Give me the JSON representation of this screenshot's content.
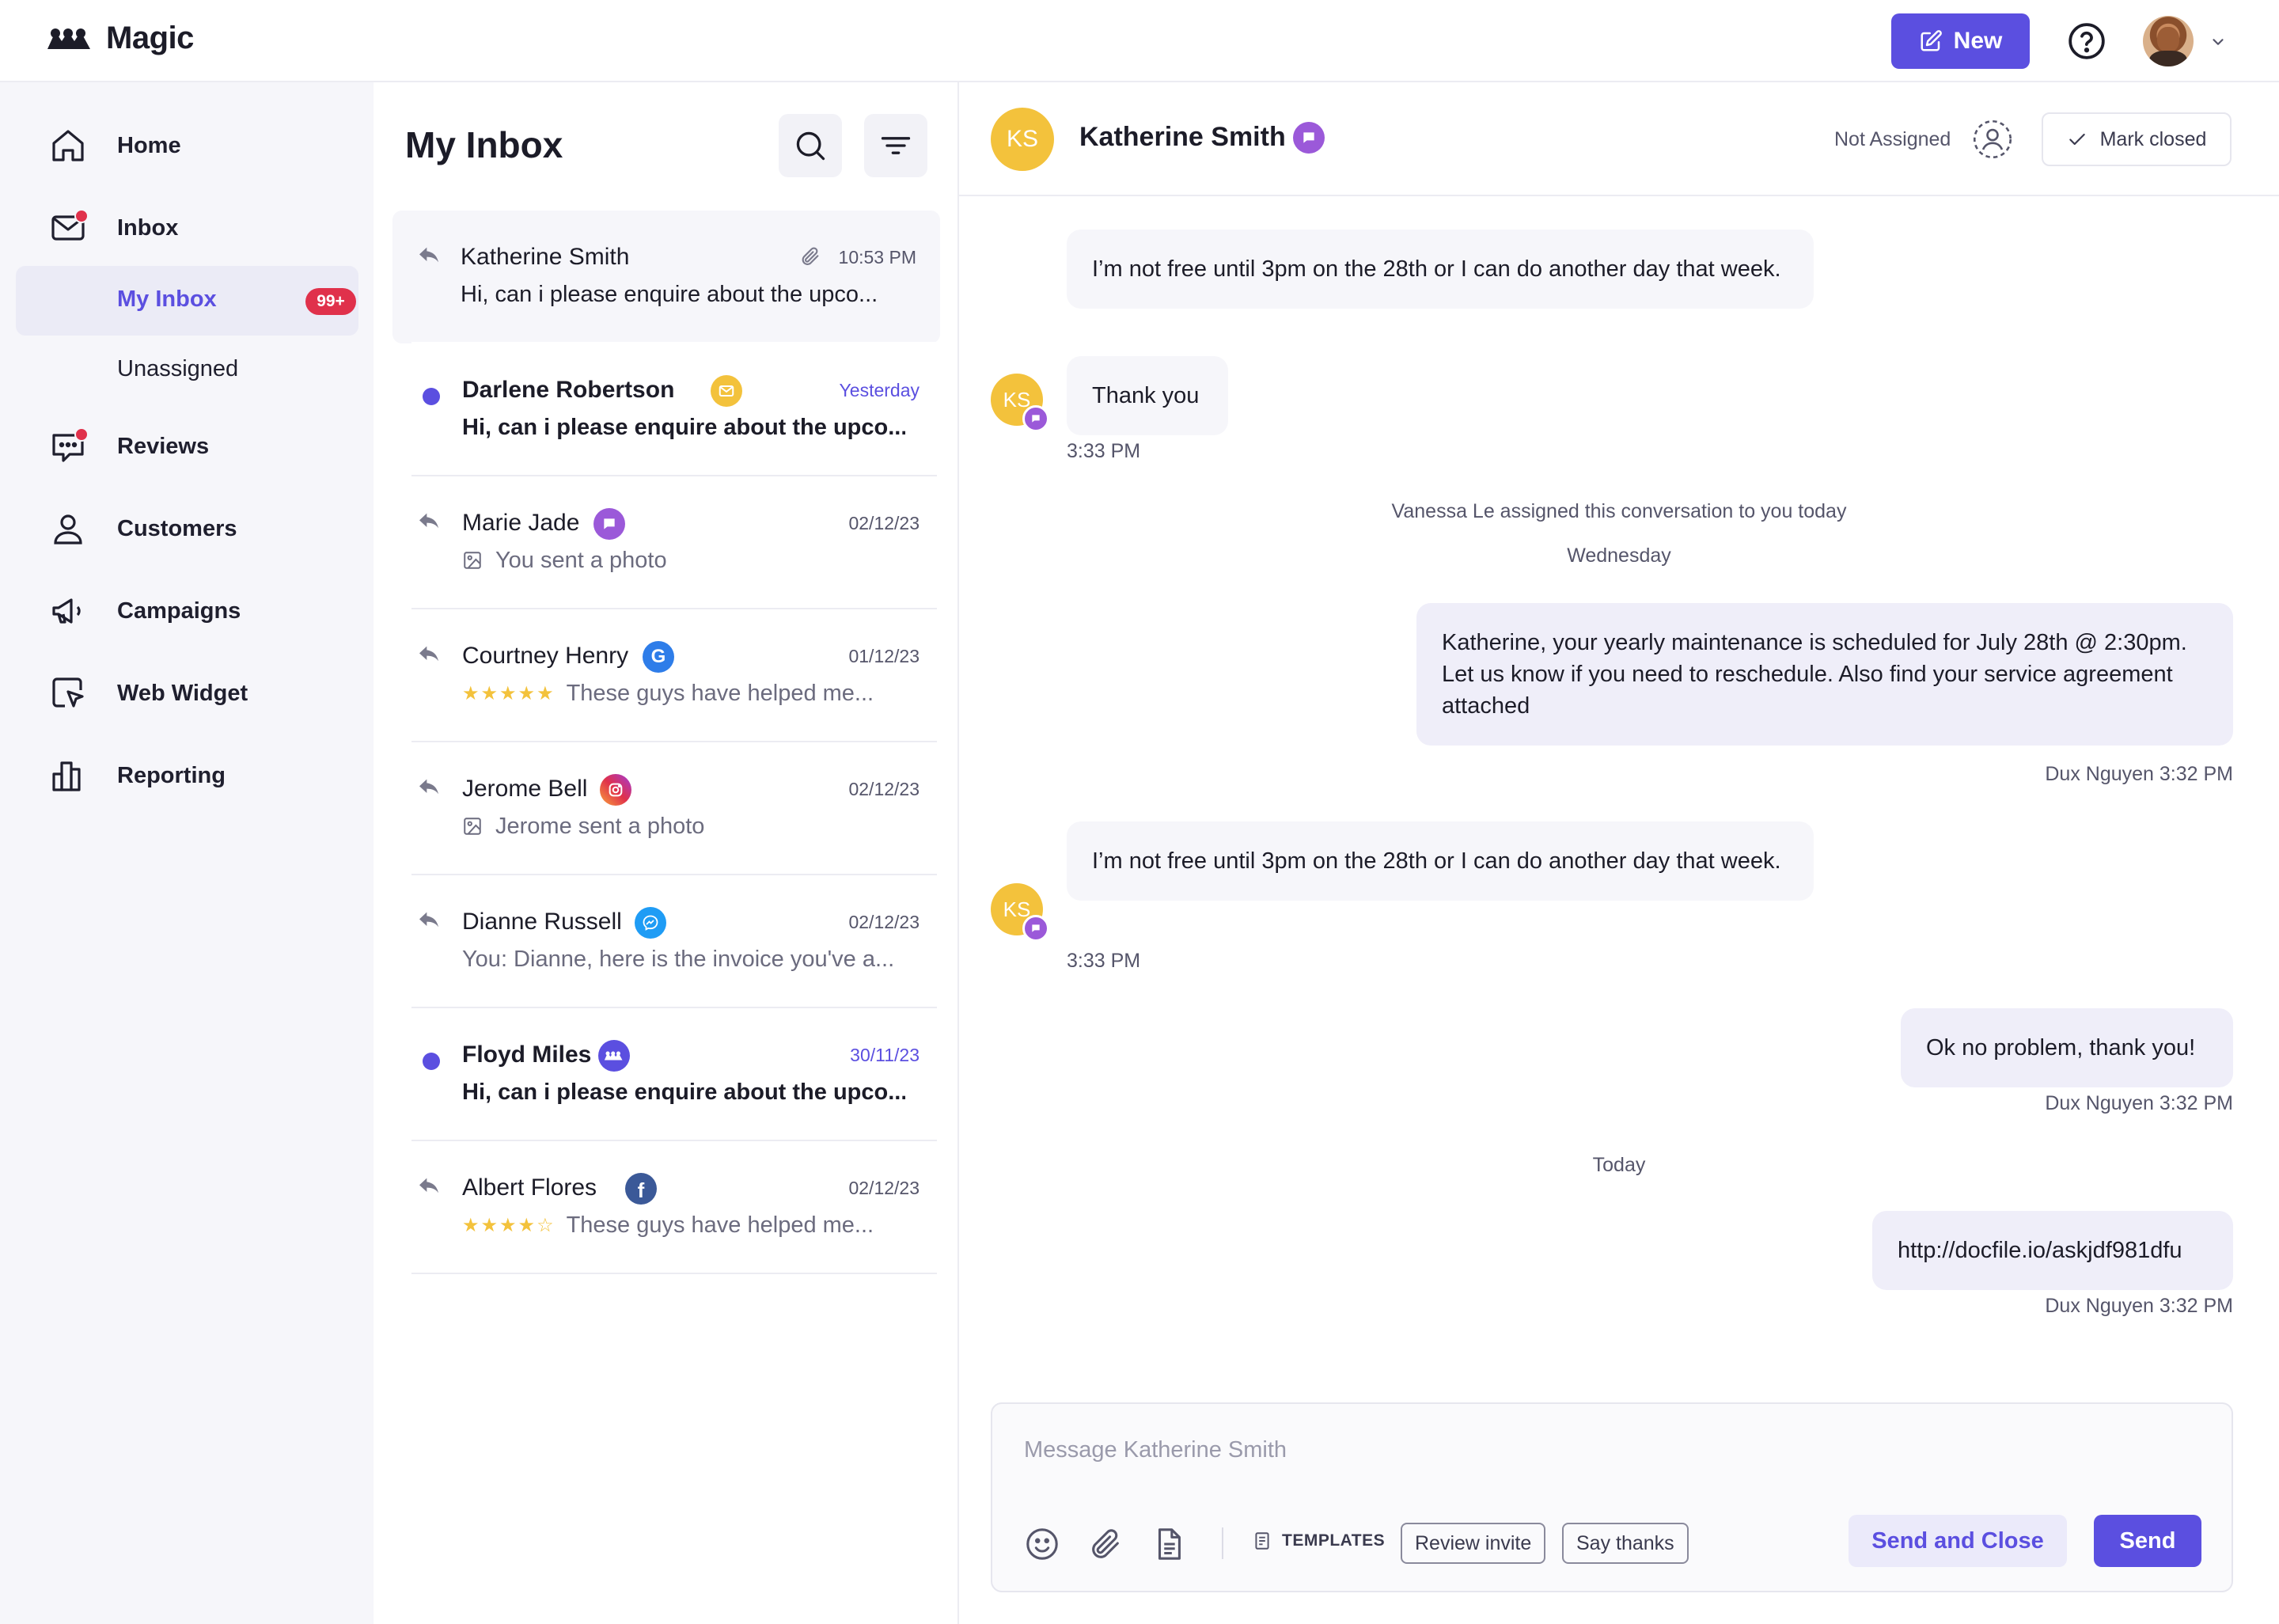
{
  "app": {
    "name": "Magic"
  },
  "topbar": {
    "new_label": "New"
  },
  "sidebar": {
    "items": [
      {
        "label": "Home",
        "icon": "home-icon"
      },
      {
        "label": "Inbox",
        "icon": "mail-icon",
        "has_notification": true
      },
      {
        "label": "Reviews",
        "icon": "chat-bubble-icon",
        "has_notification": true
      },
      {
        "label": "Customers",
        "icon": "user-icon"
      },
      {
        "label": "Campaigns",
        "icon": "megaphone-icon"
      },
      {
        "label": "Web Widget",
        "icon": "widget-cursor-icon"
      },
      {
        "label": "Reporting",
        "icon": "bar-chart-icon"
      }
    ],
    "inbox_sub": {
      "my_inbox": "My Inbox",
      "my_inbox_badge": "99+",
      "unassigned": "Unassigned"
    }
  },
  "inbox": {
    "title": "My Inbox",
    "conversations": [
      {
        "name": "Katherine Smith",
        "time": "10:53 PM",
        "preview": "Hi, can i please enquire about the upco...",
        "state": "replied",
        "channel": "none",
        "attachment": true,
        "selected": true
      },
      {
        "name": "Darlene Robertson",
        "time": "Yesterday",
        "preview": "Hi, can i please enquire about the upco...",
        "state": "unread",
        "channel": "email"
      },
      {
        "name": "Marie Jade",
        "time": "02/12/23",
        "preview": "You sent a photo",
        "state": "replied",
        "channel": "sms",
        "preview_icon": "image-icon"
      },
      {
        "name": "Courtney Henry",
        "time": "01/12/23",
        "preview": "These guys have helped me...",
        "state": "replied",
        "channel": "google",
        "stars": "★★★★★"
      },
      {
        "name": "Jerome Bell",
        "time": "02/12/23",
        "preview": "Jerome sent a photo",
        "state": "replied",
        "channel": "instagram",
        "preview_icon": "image-icon"
      },
      {
        "name": "Dianne Russell",
        "time": "02/12/23",
        "preview": "You: Dianne, here is the invoice you've a...",
        "state": "replied",
        "channel": "messenger"
      },
      {
        "name": "Floyd Miles",
        "time": "30/11/23",
        "preview": "Hi, can i please enquire about the upco...",
        "state": "unread",
        "channel": "magic"
      },
      {
        "name": "Albert Flores",
        "time": "02/12/23",
        "preview": "These guys have helped me...",
        "state": "replied",
        "channel": "facebook",
        "stars": "★★★★☆"
      }
    ]
  },
  "chat": {
    "contact_name": "Katherine Smith",
    "contact_initials": "KS",
    "assignee": "Not Assigned",
    "mark_closed": "Mark closed",
    "messages": {
      "m1": "I’m not free until 3pm on the 28th or I can do another day that week.",
      "m2": "Thank you",
      "m2_time": "3:33 PM",
      "sys_assign": "Vanessa Le assigned this conversation to you today",
      "day_wed": "Wednesday",
      "m3": "Katherine, your yearly maintenance is scheduled for July 28th @ 2:30pm. Let us know if you need to reschedule. Also find your service agreement attached",
      "m3_meta": "Dux Nguyen 3:32 PM",
      "m4": "I’m not free until 3pm on the 28th or I can do another day that week.",
      "m4_time": "3:33 PM",
      "m5": "Ok no problem, thank you!",
      "m5_meta": "Dux Nguyen 3:32 PM",
      "day_today": "Today",
      "m6": "http://docfile.io/askjdf981dfu",
      "m6_meta": "Dux Nguyen 3:32 PM"
    },
    "composer": {
      "placeholder": "Message Katherine Smith",
      "templates_label": "TEMPLATES",
      "chip_review": "Review invite",
      "chip_thanks": "Say thanks",
      "send_close": "Send and Close",
      "send": "Send"
    }
  },
  "colors": {
    "accent": "#5b4fe0",
    "alert": "#e0314b",
    "avatar": "#f3c23c",
    "sms": "#9b59d9"
  }
}
